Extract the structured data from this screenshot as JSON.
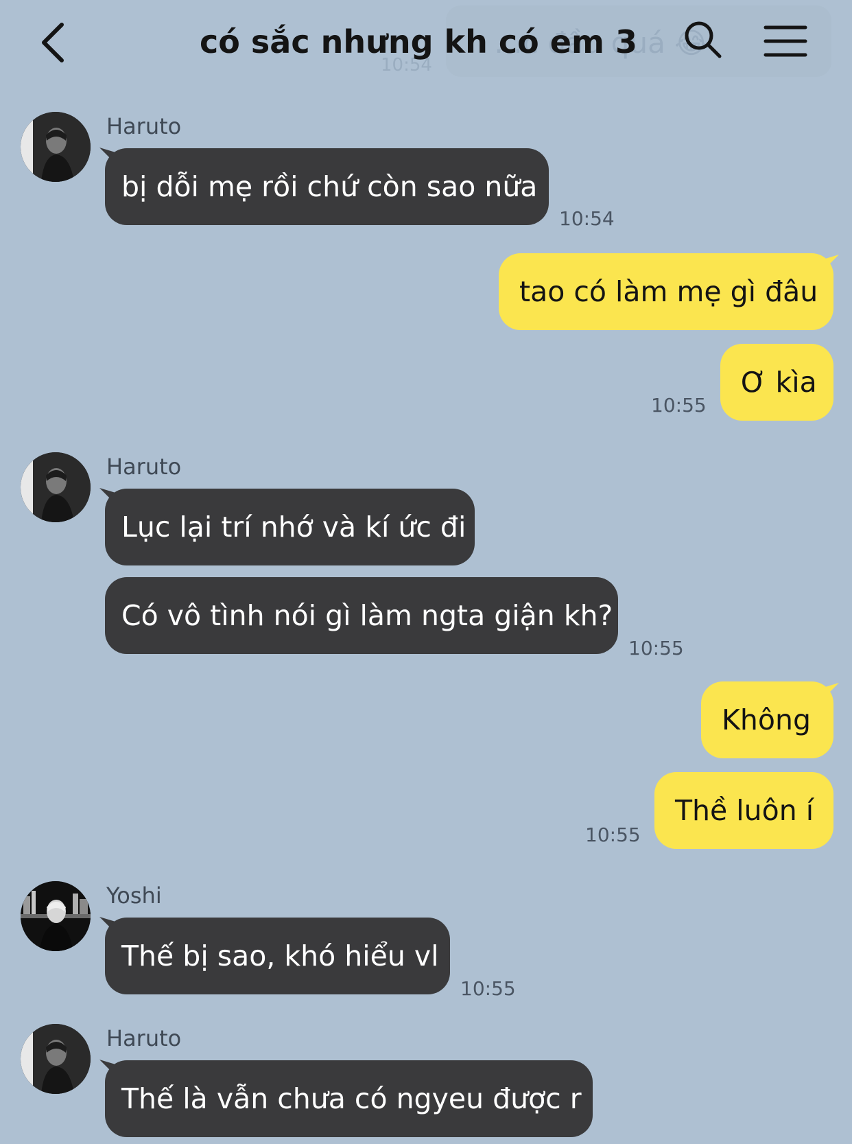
{
  "header": {
    "title": "có sắc nhưng kh có em 3",
    "ghost_message": "…c đầu quá 😂",
    "ghost_time": "10:54"
  },
  "icons": {
    "back": "chevron-left-icon",
    "search": "search-icon",
    "menu": "hamburger-menu-icon"
  },
  "colors": {
    "background": "#aec0d2",
    "incoming_bubble": "#3a3a3c",
    "outgoing_bubble": "#fbe54f"
  },
  "messages": [
    {
      "sender": "Haruto",
      "text": "bị dỗi mẹ rồi chứ còn sao nữa",
      "time": "10:54"
    },
    {
      "text": "tao có làm mẹ gì đâu"
    },
    {
      "text": "Ơ kìa",
      "time": "10:55"
    },
    {
      "sender": "Haruto",
      "text": "Lục lại trí nhớ và kí ức đi"
    },
    {
      "text": "Có vô tình nói gì làm ngta giận kh?",
      "time": "10:55"
    },
    {
      "text": "Không"
    },
    {
      "text": "Thề luôn í",
      "time": "10:55"
    },
    {
      "sender": "Yoshi",
      "text": "Thế bị sao, khó hiểu vl",
      "time": "10:55"
    },
    {
      "sender": "Haruto",
      "text": "Thế là vẫn chưa có ngyeu được r"
    }
  ]
}
